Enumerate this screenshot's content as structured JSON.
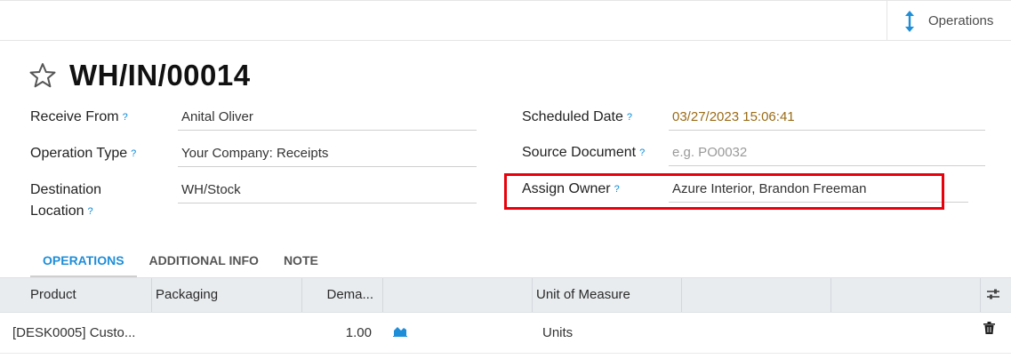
{
  "topbar": {
    "operations_label": "Operations"
  },
  "record": {
    "title": "WH/IN/00014",
    "help": "?"
  },
  "left_fields": [
    {
      "label": "Receive From",
      "value": "Anital Oliver"
    },
    {
      "label": "Operation Type",
      "value": "Your Company: Receipts"
    },
    {
      "label_line1": "Destination",
      "label_line2": "Location",
      "value": "WH/Stock"
    }
  ],
  "right_fields": [
    {
      "label": "Scheduled Date",
      "value": "03/27/2023 15:06:41"
    },
    {
      "label": "Source Document",
      "placeholder": "e.g. PO0032"
    },
    {
      "label": "Assign Owner",
      "value": "Azure Interior, Brandon Freeman"
    }
  ],
  "tabs": [
    {
      "label": "OPERATIONS"
    },
    {
      "label": "ADDITIONAL INFO"
    },
    {
      "label": "NOTE"
    }
  ],
  "table": {
    "columns": [
      "Product",
      "Packaging",
      "Dema...",
      "",
      "Unit of Measure",
      "",
      ""
    ],
    "rows": [
      {
        "product": "[DESK0005] Custo...",
        "packaging": "",
        "demand": "1.00",
        "uom": "Units"
      }
    ]
  },
  "colors": {
    "accent": "#1f8ed8",
    "highlight": "#e8000b",
    "date": "#9a6b17"
  },
  "icons": [
    "operations-arrows-icon",
    "star-icon",
    "help-icon",
    "column-settings-icon",
    "forecast-chart-icon",
    "trash-icon"
  ]
}
